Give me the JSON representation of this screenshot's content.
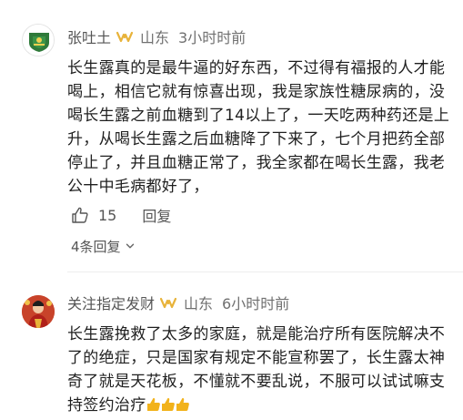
{
  "comments": [
    {
      "username": "张吐土",
      "location": "山东",
      "time": "3小时时前",
      "text_lines": [
        "长生露真的是最牛逼的好东西，不过得有福报的人才能",
        "喝上，相信它就有惊喜出现，我是家族性糖尿病的，没",
        "喝长生露之前血糖到了14以上了，一天吃两种药还是上",
        "升，从喝长生露之后血糖降了下来了，七个月把药全部",
        "停止了，并且血糖正常了，我全家都在喝长生露，我老",
        "公十中毛病都好了，"
      ],
      "likes": "15",
      "reply_label": "回复",
      "replies_link": "4条回复",
      "avatar_caption": "THE LIFE OF"
    },
    {
      "username": "关注指定发财",
      "location": "山东",
      "time": "6小时时前",
      "text_lines": [
        "长生露挽救了太多的家庭，就是能治疗所有医院解决不",
        "了的绝症，只是国家有规定不能宣称罢了，长生露太神",
        "奇了就是天花板，不懂就不要乱说，不服可以试试嘛支",
        "持签约治疗"
      ],
      "emojis": [
        "thumbs-up",
        "thumbs-up",
        "thumbs-up"
      ]
    }
  ],
  "colors": {
    "vip_badge": "#e8b33a",
    "meta_text": "#707070",
    "emoji": "#f2b21a"
  }
}
